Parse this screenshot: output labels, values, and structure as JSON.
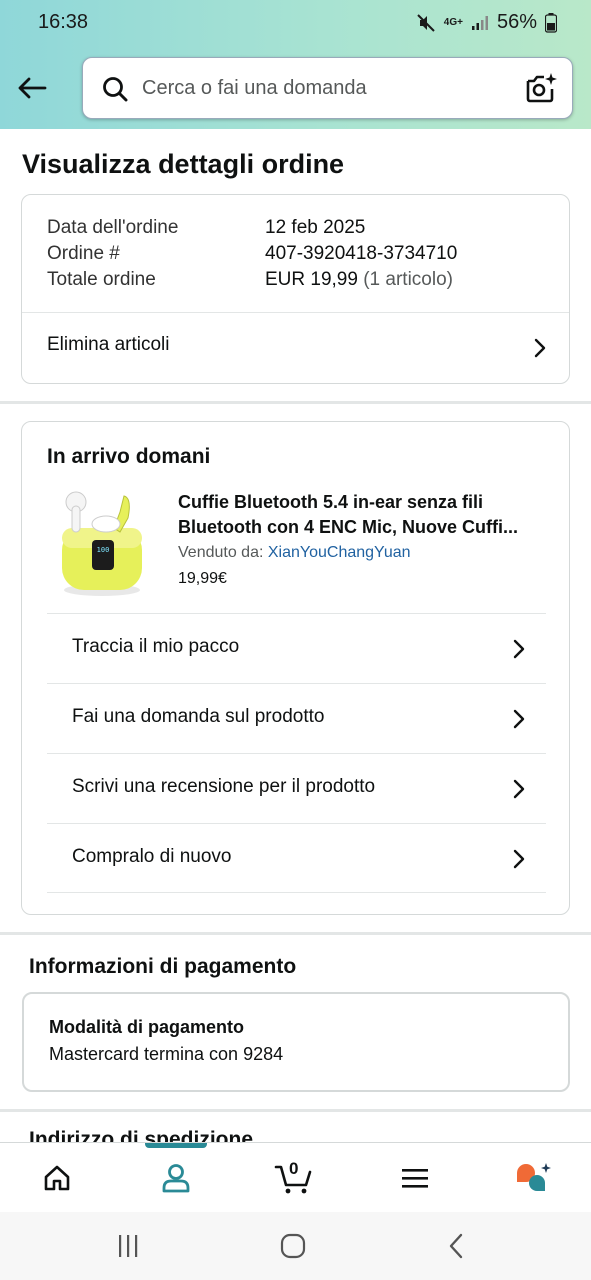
{
  "status_bar": {
    "time": "16:38",
    "network": "4G+",
    "battery": "56%"
  },
  "search": {
    "placeholder": "Cerca o fai una domanda"
  },
  "page": {
    "title": "Visualizza dettagli ordine"
  },
  "order_summary": {
    "rows": [
      {
        "label": "Data dell'ordine",
        "value": "12 feb 2025"
      },
      {
        "label": "Ordine #",
        "value": "407-3920418-3734710"
      },
      {
        "label": "Totale ordine",
        "value": "EUR 19,99",
        "extra": " (1 articolo)"
      }
    ],
    "delete_items_label": "Elimina articoli"
  },
  "shipment": {
    "title": "In arrivo domani",
    "product": {
      "title_line1": "Cuffie Bluetooth 5.4 in-ear senza fili",
      "title_line2": "Bluetooth con 4 ENC Mic, Nuove Cuffi...",
      "sold_by_label": "Venduto da: ",
      "seller": "XianYouChangYuan",
      "price": "19,99€",
      "image_display_text": "100"
    },
    "actions": [
      {
        "label": "Traccia il mio pacco"
      },
      {
        "label": "Fai una domanda sul prodotto"
      },
      {
        "label": "Scrivi una recensione per il prodotto"
      },
      {
        "label": "Compralo di nuovo"
      }
    ]
  },
  "payment": {
    "section_title": "Informazioni di pagamento",
    "method_title": "Modalità di pagamento",
    "method_value": "Mastercard  termina con 9284"
  },
  "shipping_address": {
    "section_title": "Indirizzo di spedizione"
  },
  "bottom_nav": {
    "cart_count": "0",
    "items": [
      {
        "icon": "home-icon"
      },
      {
        "icon": "account-icon",
        "active": true
      },
      {
        "icon": "cart-icon"
      },
      {
        "icon": "menu-icon"
      },
      {
        "icon": "rufus-ai-icon"
      }
    ],
    "active_color": "#2a8a96"
  },
  "colors": {
    "header_gradient_start": "#8fd7d9",
    "header_gradient_end": "#b9e8c9",
    "link": "#2162a1",
    "product_accent": "#e6f05a"
  }
}
